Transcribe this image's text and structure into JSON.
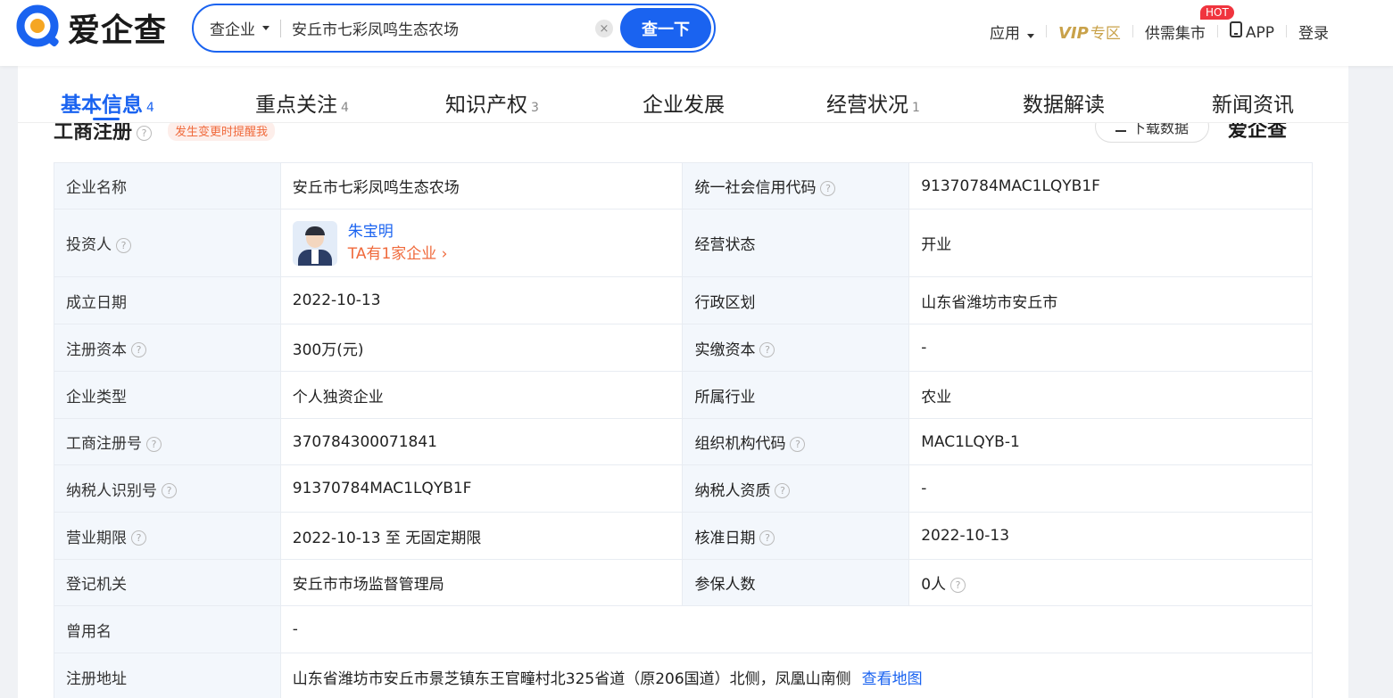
{
  "header": {
    "logo_text": "爱企查",
    "search": {
      "type_label": "查企业",
      "value": "安丘市七彩凤鸣生态农场",
      "button": "查一下"
    },
    "nav": {
      "apps": "应用",
      "vip": "VIP",
      "vip_zone": "专区",
      "market": "供需集市",
      "hot": "HOT",
      "app": "APP",
      "login": "登录"
    }
  },
  "tabs": [
    {
      "label": "基本信息",
      "count": "4"
    },
    {
      "label": "重点关注",
      "count": "4"
    },
    {
      "label": "知识产权",
      "count": "3"
    },
    {
      "label": "企业发展",
      "count": ""
    },
    {
      "label": "经营状况",
      "count": "1"
    },
    {
      "label": "数据解读",
      "count": ""
    },
    {
      "label": "新闻资讯",
      "count": ""
    }
  ],
  "section": {
    "title": "工商注册",
    "remind": "发生变更时提醒我",
    "download": "下载数据",
    "watermark": "爱企查"
  },
  "info": {
    "company_name_label": "企业名称",
    "company_name": "安丘市七彩凤鸣生态农场",
    "credit_code_label": "统一社会信用代码",
    "credit_code": "91370784MAC1LQYB1F",
    "investor_label": "投资人",
    "investor_name": "朱宝明",
    "investor_companies": "TA有1家企业",
    "status_label": "经营状态",
    "status": "开业",
    "founded_label": "成立日期",
    "founded": "2022-10-13",
    "region_label": "行政区划",
    "region": "山东省潍坊市安丘市",
    "capital_label": "注册资本",
    "capital": "300万(元)",
    "paid_label": "实缴资本",
    "paid": "-",
    "type_label": "企业类型",
    "type": "个人独资企业",
    "industry_label": "所属行业",
    "industry": "农业",
    "reg_no_label": "工商注册号",
    "reg_no": "370784300071841",
    "org_code_label": "组织机构代码",
    "org_code": "MAC1LQYB-1",
    "taxpayer_id_label": "纳税人识别号",
    "taxpayer_id": "91370784MAC1LQYB1F",
    "taxpayer_qual_label": "纳税人资质",
    "taxpayer_qual": "-",
    "term_label": "营业期限",
    "term": "2022-10-13 至 无固定期限",
    "approved_label": "核准日期",
    "approved": "2022-10-13",
    "authority_label": "登记机关",
    "authority": "安丘市市场监督管理局",
    "insured_label": "参保人数",
    "insured": "0人",
    "former_name_label": "曾用名",
    "former_name": "-",
    "address_label": "注册地址",
    "address": "山东省潍坊市安丘市景芝镇东王官疃村北325省道（原206国道）北侧，凤凰山南侧",
    "map_link": "查看地图"
  }
}
